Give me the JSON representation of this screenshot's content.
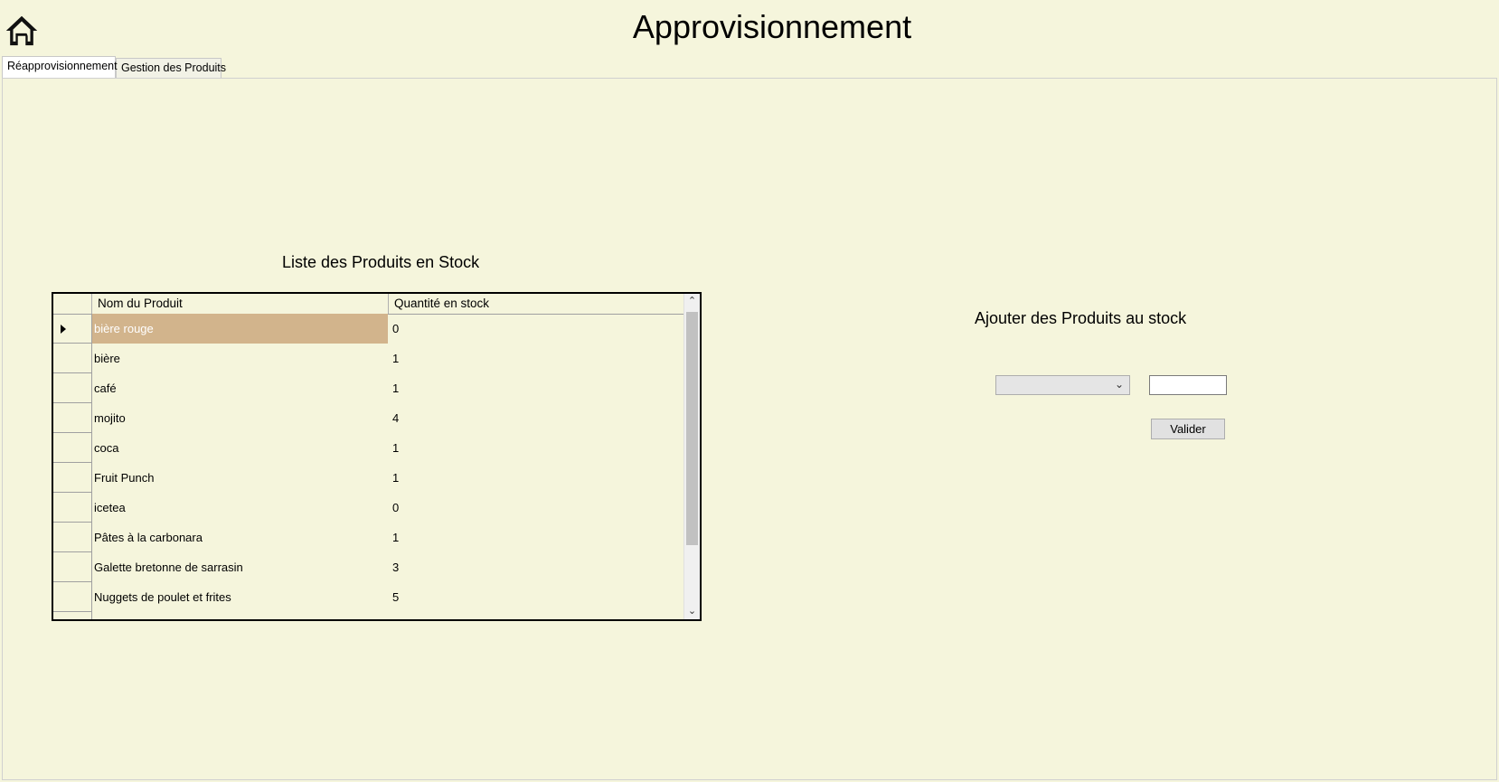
{
  "header": {
    "title": "Approvisionnement",
    "home_icon": "home-icon"
  },
  "tabs": [
    {
      "label": "Réapprovisionnement",
      "active": true
    },
    {
      "label": "Gestion des Produits",
      "active": false
    }
  ],
  "stock_list": {
    "title": "Liste des Produits en Stock",
    "columns": [
      "Nom du Produit",
      "Quantité en stock"
    ],
    "rows": [
      {
        "name": "bière rouge",
        "qty": "0",
        "selected": true
      },
      {
        "name": "bière",
        "qty": "1"
      },
      {
        "name": "café",
        "qty": "1"
      },
      {
        "name": "mojito",
        "qty": "4"
      },
      {
        "name": "coca",
        "qty": "1"
      },
      {
        "name": "Fruit Punch",
        "qty": "1"
      },
      {
        "name": "icetea",
        "qty": "0"
      },
      {
        "name": "Pâtes à la carbonara",
        "qty": "1"
      },
      {
        "name": "Galette bretonne de sarrasin",
        "qty": "3"
      },
      {
        "name": "Nuggets de poulet et frites",
        "qty": "5"
      }
    ]
  },
  "add_stock": {
    "title": "Ajouter des Produits au stock",
    "product_select_value": "",
    "quantity_value": "",
    "submit_label": "Valider"
  },
  "colors": {
    "background": "#f5f5dc",
    "selection": "#d2b48c"
  }
}
